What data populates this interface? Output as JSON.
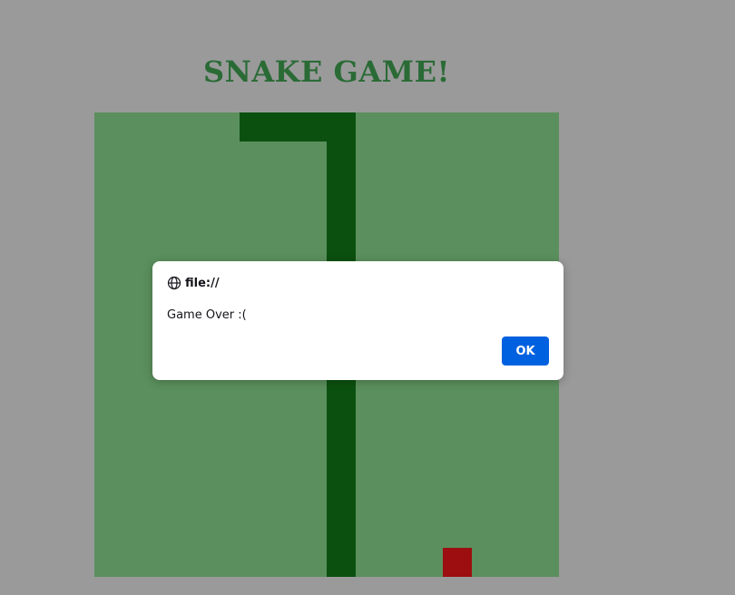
{
  "page": {
    "title": "SNAKE GAME!"
  },
  "game": {
    "grid_size": 16,
    "snake": [
      [
        5,
        0
      ],
      [
        6,
        0
      ],
      [
        7,
        0
      ],
      [
        8,
        0
      ],
      [
        8,
        1
      ],
      [
        8,
        2
      ],
      [
        8,
        3
      ],
      [
        8,
        4
      ],
      [
        8,
        5
      ],
      [
        8,
        6
      ],
      [
        8,
        7
      ],
      [
        8,
        8
      ],
      [
        8,
        9
      ],
      [
        8,
        10
      ],
      [
        8,
        11
      ],
      [
        8,
        12
      ],
      [
        8,
        13
      ],
      [
        8,
        14
      ],
      [
        8,
        15
      ]
    ],
    "food": [
      12,
      15
    ],
    "colors": {
      "background": "#9a9a9b",
      "board": "#5b8f5d",
      "snake": "#0b500f",
      "food": "#9c0e10",
      "title": "#2a6b35"
    }
  },
  "dialog": {
    "origin": "file://",
    "message": "Game Over :(",
    "ok_label": "OK",
    "icon": "globe-icon"
  }
}
